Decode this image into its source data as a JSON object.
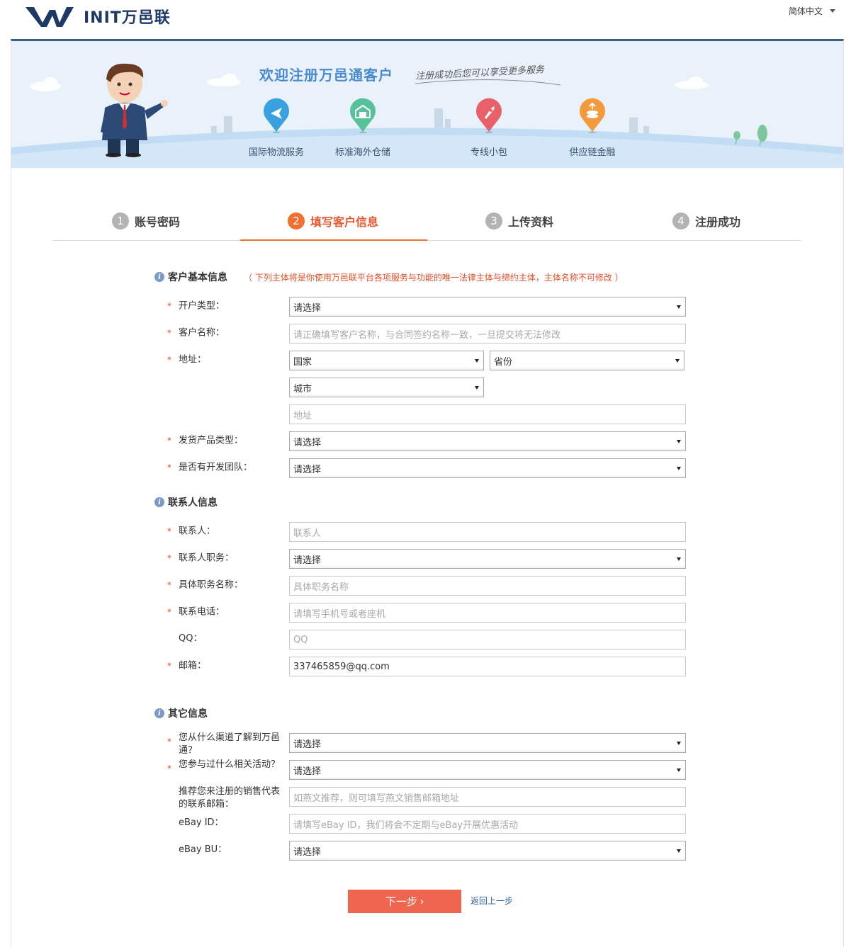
{
  "header": {
    "logo_text": "INIT万邑联",
    "language": "简体中文"
  },
  "banner": {
    "title": "欢迎注册万邑通客户",
    "slogan": "注册成功后您可以享受更多服务",
    "services": [
      {
        "label": "国际物流服务",
        "icon": "plane-icon",
        "color": "#3aa1e0"
      },
      {
        "label": "标准海外仓储",
        "icon": "warehouse-icon",
        "color": "#57c29a"
      },
      {
        "label": "专线小包",
        "icon": "rocket-icon",
        "color": "#e8606a"
      },
      {
        "label": "供应链金融",
        "icon": "coins-icon",
        "color": "#f39a3c"
      }
    ]
  },
  "steps": [
    {
      "num": "1",
      "label": "账号密码",
      "active": false
    },
    {
      "num": "2",
      "label": "填写客户信息",
      "active": true
    },
    {
      "num": "3",
      "label": "上传资料",
      "active": false
    },
    {
      "num": "4",
      "label": "注册成功",
      "active": false
    }
  ],
  "sections": {
    "basic": {
      "title": "客户基本信息",
      "note": "（ 下列主体将是你使用万邑联平台各项服务与功能的唯一法律主体与缔约主体，主体名称不可修改 ）"
    },
    "contact": {
      "title": "联系人信息"
    },
    "other": {
      "title": "其它信息"
    }
  },
  "fields": {
    "account_type": {
      "label": "开户类型：",
      "value": "请选择"
    },
    "customer_name": {
      "label": "客户名称：",
      "placeholder": "请正确填写客户名称，与合同签约名称一致，一旦提交将无法修改"
    },
    "address": {
      "label": "地址：",
      "country": "国家",
      "province": "省份",
      "city": "城市",
      "detail_placeholder": "地址"
    },
    "product_type": {
      "label": "发货产品类型：",
      "value": "请选择"
    },
    "dev_team": {
      "label": "是否有开发团队：",
      "value": "请选择"
    },
    "contact_person": {
      "label": "联系人：",
      "placeholder": "联系人"
    },
    "contact_role": {
      "label": "联系人职务：",
      "value": "请选择"
    },
    "role_name": {
      "label": "具体职务名称：",
      "placeholder": "具体职务名称"
    },
    "phone": {
      "label": "联系电话：",
      "placeholder": "请填写手机号或者座机"
    },
    "qq": {
      "label": "QQ：",
      "placeholder": "QQ"
    },
    "email": {
      "label": "邮箱：",
      "value": "337465859@qq.com"
    },
    "channel": {
      "label": "您从什么渠道了解到万邑通？",
      "value": "请选择"
    },
    "activities": {
      "label": "您参与过什么相关活动？",
      "value": "请选择"
    },
    "referrer": {
      "label": "推荐您来注册的销售代表的联系邮箱：",
      "placeholder": "如燕文推荐，则可填写燕文销售邮箱地址"
    },
    "ebay_id": {
      "label": "eBay ID：",
      "placeholder": "请填写eBay ID，我们将会不定期与eBay开展优惠活动"
    },
    "ebay_bu": {
      "label": "eBay BU：",
      "value": "请选择"
    }
  },
  "actions": {
    "next": "下一步",
    "back": "返回上一步"
  }
}
